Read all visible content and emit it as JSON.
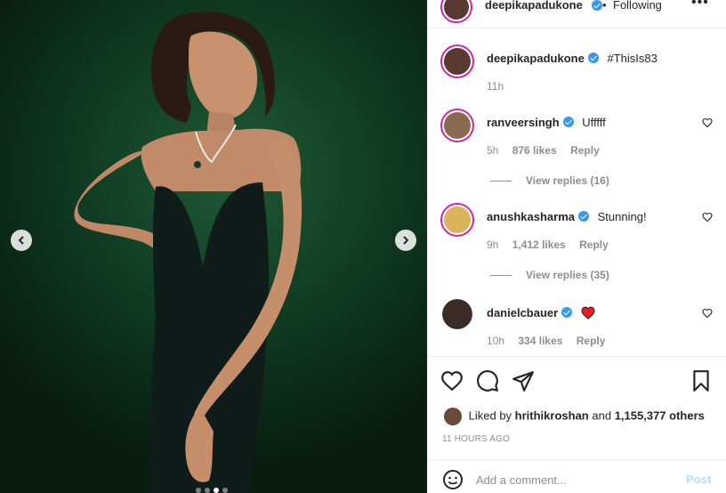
{
  "post": {
    "author": "deepikapadukone",
    "follow_status": "Following",
    "separator": "•",
    "more": "•••",
    "caption_hashtag": "#ThisIs83",
    "caption_time": "11h",
    "carousel_dots": 4,
    "carousel_active_index": 2
  },
  "comments": [
    {
      "user": "ranveersingh",
      "text": "Ufffff",
      "time": "5h",
      "likes": "876 likes",
      "reply": "Reply",
      "view_replies": "View replies (16)",
      "avatar_color": "#8a6a4f"
    },
    {
      "user": "anushkasharma",
      "text": "Stunning!",
      "time": "9h",
      "likes": "1,412 likes",
      "reply": "Reply",
      "view_replies": "View replies (35)",
      "avatar_color": "#d9b45a"
    },
    {
      "user": "danielcbauer",
      "text": "",
      "emoji": "heart",
      "time": "10h",
      "likes": "334 likes",
      "reply": "Reply",
      "avatar_color": "#3a2b26"
    }
  ],
  "likes_line": {
    "prefix": "Liked by",
    "user": "hrithikroshan",
    "middle": "and",
    "others": "1,155,377 others"
  },
  "timestamp": "11 HOURS AGO",
  "comment_box": {
    "placeholder": "Add a comment...",
    "post_label": "Post"
  },
  "colors": {
    "verified": "#3897f0",
    "heart_red": "#ed4956",
    "ring": "#d6249f",
    "post_disabled": "#b2dffc"
  }
}
